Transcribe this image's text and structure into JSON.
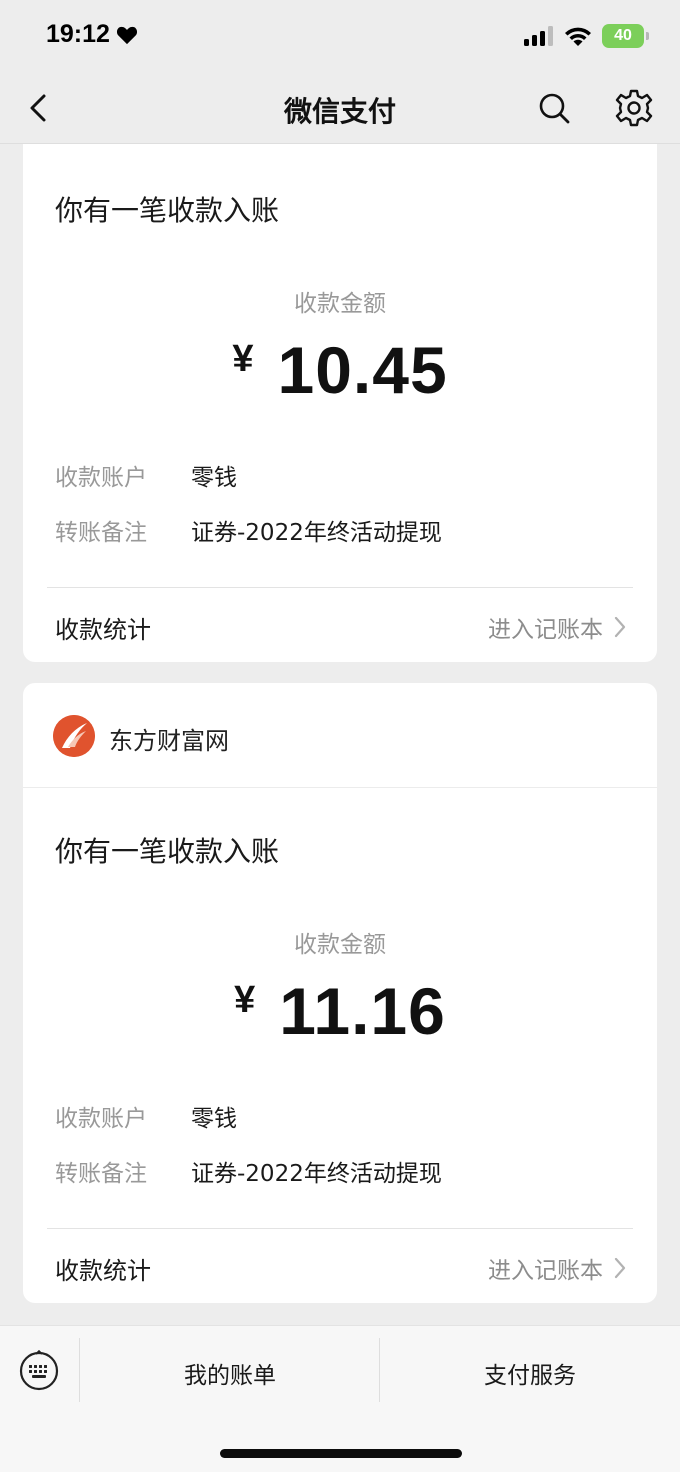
{
  "status_bar": {
    "time": "19:12",
    "battery": "40"
  },
  "nav": {
    "title": "微信支付"
  },
  "cards": [
    {
      "notice_title": "你有一笔收款入账",
      "amount_label": "收款金额",
      "currency": "¥",
      "amount": "10.45",
      "account_key": "收款账户",
      "account_value": "零钱",
      "remark_key": "转账备注",
      "remark_value": "证券-2022年终活动提现",
      "stats_label": "收款统计",
      "stats_link": "进入记账本"
    },
    {
      "brand_name": "东方财富网",
      "notice_title": "你有一笔收款入账",
      "amount_label": "收款金额",
      "currency": "¥",
      "amount": "11.16",
      "account_key": "收款账户",
      "account_value": "零钱",
      "remark_key": "转账备注",
      "remark_value": "证券-2022年终活动提现",
      "stats_label": "收款统计",
      "stats_link": "进入记账本"
    }
  ],
  "bottom_bar": {
    "my_bills": "我的账单",
    "pay_services": "支付服务"
  },
  "colors": {
    "background": "#ededed",
    "brand_logo": "#e0532e",
    "battery": "#7ccf5a"
  }
}
